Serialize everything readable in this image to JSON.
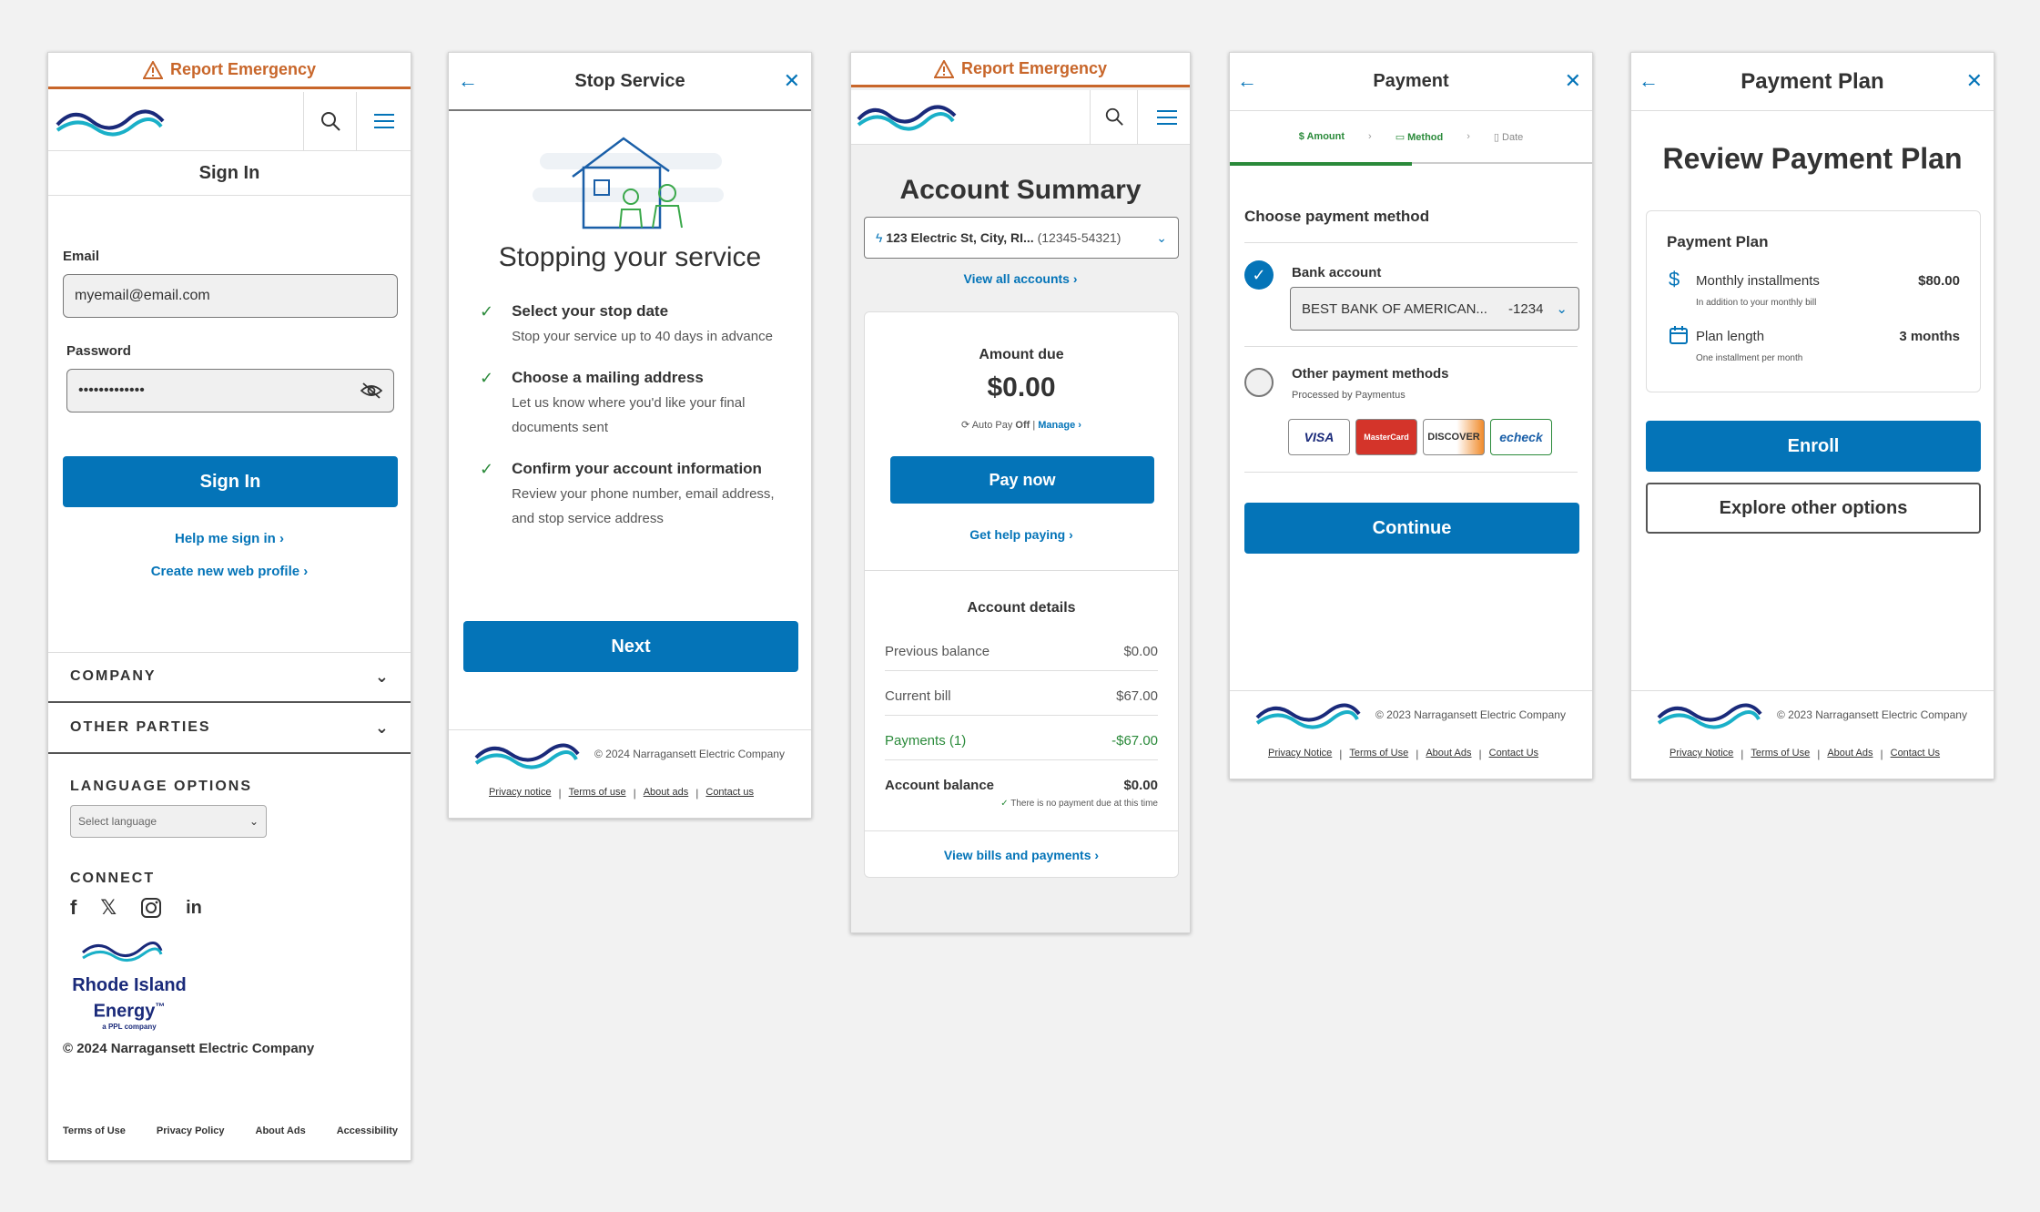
{
  "colors": {
    "brand": "#0474b8",
    "emergency": "#c8662a",
    "success": "#2a8a3a",
    "background": "#f2f2f2"
  },
  "emergency": {
    "label": "Report Emergency",
    "icon": "warning-icon"
  },
  "signin": {
    "title": "Sign In",
    "email_label": "Email",
    "email_value": "myemail@email.com",
    "password_label": "Password",
    "password_value": "•••••••••••••",
    "button": "Sign In",
    "help_link": "Help me sign in",
    "create_link": "Create new web profile",
    "company": "COMPANY",
    "other_parties": "OTHER PARTIES",
    "language_title": "LANGUAGE OPTIONS",
    "language_placeholder": "Select language",
    "connect": "CONNECT",
    "brand_line1": "Rhode Island",
    "brand_line2": "Energy",
    "brand_tm": "™",
    "brand_sub": "a PPL company",
    "copyright": "© 2024 Narragansett Electric Company",
    "footer_links": [
      "Terms of Use",
      "Privacy Policy",
      "About Ads",
      "Accessibility"
    ]
  },
  "stop": {
    "header": "Stop Service",
    "title": "Stopping your service",
    "steps": [
      {
        "title": "Select your stop date",
        "desc": "Stop your service up to 40 days in advance"
      },
      {
        "title": "Choose a mailing address",
        "desc": "Let us know where you'd like your final documents sent"
      },
      {
        "title": "Confirm your account information",
        "desc": "Review your phone number, email address, and stop service address"
      }
    ],
    "button": "Next",
    "copyright": "© 2024 Narragansett Electric Company",
    "footer_links": [
      "Privacy notice",
      "Terms of use",
      "About ads",
      "Contact us"
    ]
  },
  "summary": {
    "title": "Account Summary",
    "account": "123 Electric St, City, RI...",
    "account_num": "(12345-54321)",
    "view_all": "View all accounts",
    "amount_due_label": "Amount due",
    "amount_due": "$0.00",
    "autopay_label": "Auto Pay",
    "autopay_state": "Off",
    "manage": "Manage",
    "pay_now": "Pay now",
    "help_paying": "Get help paying",
    "details_title": "Account details",
    "rows": [
      {
        "label": "Previous balance",
        "value": "$0.00"
      },
      {
        "label": "Current bill",
        "value": "$67.00"
      },
      {
        "label": "Payments (1)",
        "value": "-$67.00"
      }
    ],
    "balance_label": "Account balance",
    "balance_value": "$0.00",
    "no_payment": "There is no payment due at this time",
    "view_bills": "View bills and payments"
  },
  "payment": {
    "header": "Payment",
    "steps": [
      "Amount",
      "Method",
      "Date"
    ],
    "choose": "Choose payment method",
    "bank_label": "Bank account",
    "bank_value": "BEST BANK OF AMERICAN...",
    "bank_last4": "-1234",
    "other_label": "Other payment methods",
    "other_sub": "Processed by Paymentus",
    "cards": [
      "VISA",
      "MasterCard",
      "DISCOVER",
      "echeck"
    ],
    "button": "Continue",
    "copyright": "© 2023 Narragansett Electric Company",
    "footer_links": [
      "Privacy Notice",
      "Terms of Use",
      "About Ads",
      "Contact Us"
    ]
  },
  "plan": {
    "header": "Payment Plan",
    "title": "Review Payment Plan",
    "card_title": "Payment Plan",
    "monthly_label": "Monthly installments",
    "monthly_value": "$80.00",
    "monthly_sub": "In addition to your monthly bill",
    "length_label": "Plan length",
    "length_value": "3 months",
    "length_sub": "One installment per month",
    "enroll": "Enroll",
    "explore": "Explore other options",
    "copyright": "© 2023 Narragansett Electric Company",
    "footer_links": [
      "Privacy Notice",
      "Terms of Use",
      "About Ads",
      "Contact Us"
    ]
  }
}
